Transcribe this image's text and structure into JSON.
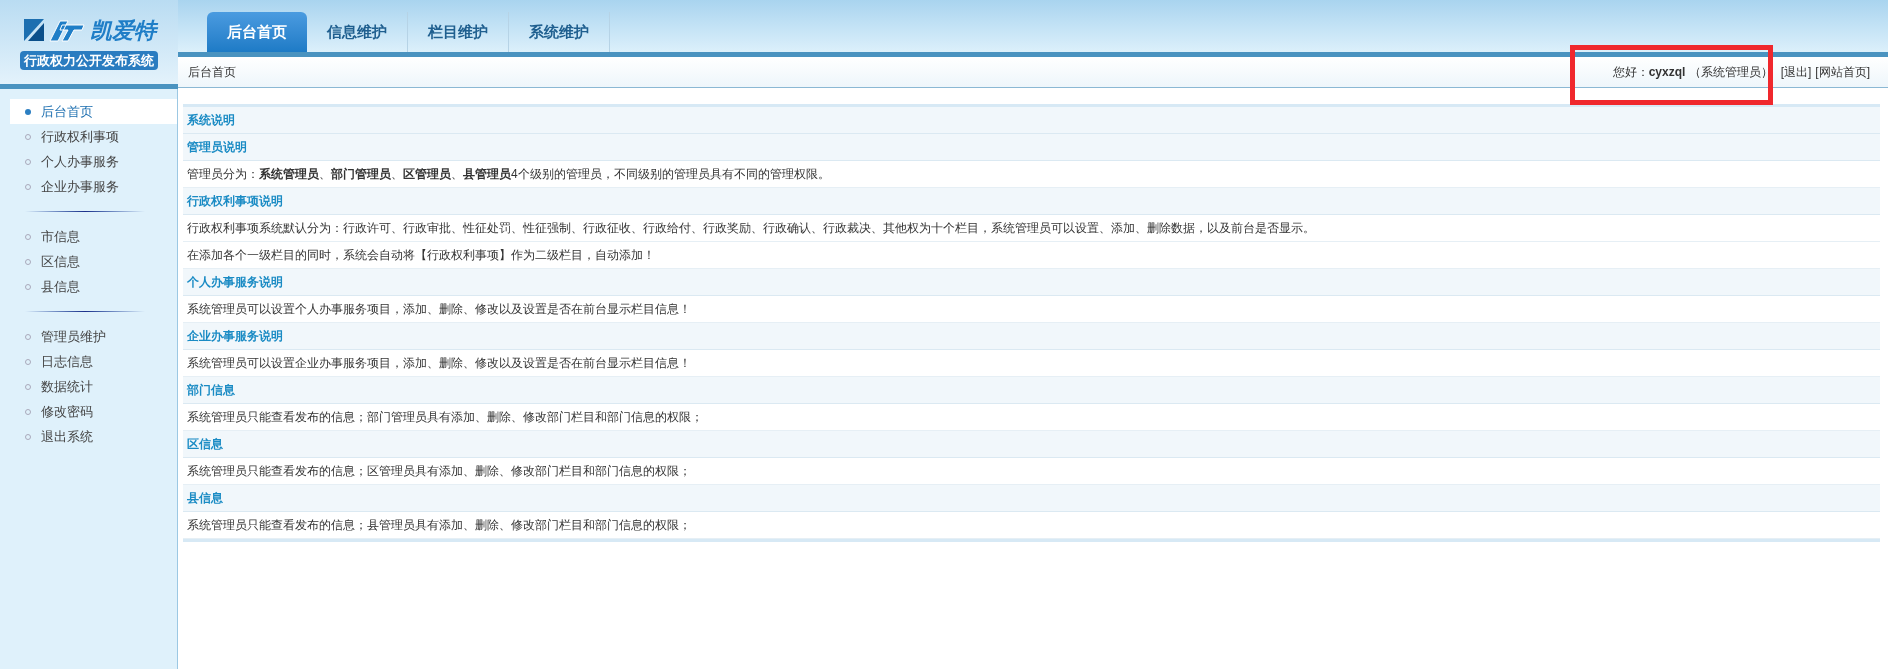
{
  "logo": {
    "name": "凯爱特",
    "subtitle": "行政权力公开发布系统"
  },
  "tabs": [
    {
      "label": "后台首页",
      "selected": true
    },
    {
      "label": "信息维护",
      "selected": false
    },
    {
      "label": "栏目维护",
      "selected": false
    },
    {
      "label": "系统维护",
      "selected": false
    }
  ],
  "breadcrumb": "后台首页",
  "user_bar": {
    "greeting": "您好：**cyxzql** （系统管理员）",
    "links": [
      "[退出]",
      "[网站首页]"
    ]
  },
  "sidebar": {
    "groups": [
      [
        {
          "label": "后台首页",
          "selected": true
        },
        {
          "label": "行政权利事项",
          "selected": false
        },
        {
          "label": "个人办事服务",
          "selected": false
        },
        {
          "label": "企业办事服务",
          "selected": false
        }
      ],
      [
        {
          "label": "市信息",
          "selected": false
        },
        {
          "label": "区信息",
          "selected": false
        },
        {
          "label": "县信息",
          "selected": false
        }
      ],
      [
        {
          "label": "管理员维护",
          "selected": false
        },
        {
          "label": "日志信息",
          "selected": false
        },
        {
          "label": "数据统计",
          "selected": false
        },
        {
          "label": "修改密码",
          "selected": false
        },
        {
          "label": "退出系统",
          "selected": false
        }
      ]
    ]
  },
  "content": [
    {
      "kind": "heading",
      "text": "系统说明"
    },
    {
      "kind": "heading",
      "text": "管理员说明"
    },
    {
      "kind": "text",
      "text": "管理员分为：**系统管理员**、**部门管理员**、**区管理员**、**县管理员**4个级别的管理员，不同级别的管理员具有不同的管理权限。"
    },
    {
      "kind": "heading",
      "text": "行政权利事项说明"
    },
    {
      "kind": "text",
      "text": "行政权利事项系统默认分为：行政许可、行政审批、性征处罚、性征强制、行政征收、行政给付、行政奖励、行政确认、行政裁决、其他权为十个栏目，系统管理员可以设置、添加、删除数据，以及前台是否显示。"
    },
    {
      "kind": "text",
      "text": "在添加各个一级栏目的同时，系统会自动将【行政权利事项】作为二级栏目，自动添加！"
    },
    {
      "kind": "heading",
      "text": "个人办事服务说明"
    },
    {
      "kind": "text",
      "text": "系统管理员可以设置个人办事服务项目，添加、删除、修改以及设置是否在前台显示栏目信息！"
    },
    {
      "kind": "heading",
      "text": "企业办事服务说明"
    },
    {
      "kind": "text",
      "text": "系统管理员可以设置企业办事服务项目，添加、删除、修改以及设置是否在前台显示栏目信息！"
    },
    {
      "kind": "heading",
      "text": "部门信息"
    },
    {
      "kind": "text",
      "text": "系统管理员只能查看发布的信息；部门管理员具有添加、删除、修改部门栏目和部门信息的权限；"
    },
    {
      "kind": "heading",
      "text": "区信息"
    },
    {
      "kind": "text",
      "text": "系统管理员只能查看发布的信息；区管理员具有添加、删除、修改部门栏目和部门信息的权限；"
    },
    {
      "kind": "heading",
      "text": "县信息"
    },
    {
      "kind": "text",
      "text": "系统管理员只能查看发布的信息；县管理员具有添加、删除、修改部门栏目和部门信息的权限；"
    }
  ]
}
